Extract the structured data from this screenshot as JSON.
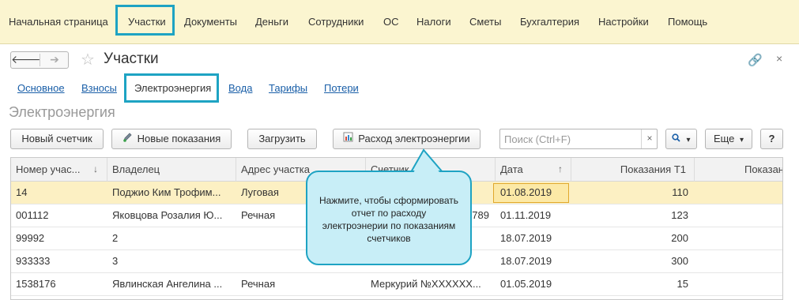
{
  "menu": {
    "items": [
      "Начальная страница",
      "Участки",
      "Документы",
      "Деньги",
      "Сотрудники",
      "ОС",
      "Налоги",
      "Сметы",
      "Бухгалтерия",
      "Настройки",
      "Помощь"
    ],
    "active": "Участки"
  },
  "header": {
    "back_icon": "arrow-left-icon",
    "forward_icon": "arrow-right-icon",
    "back_glyph": "🡐",
    "forward_glyph": "➔",
    "star_glyph": "☆",
    "link_glyph": "🔗",
    "close_glyph": "×",
    "title": "Участки"
  },
  "tabs": {
    "items": [
      "Основное",
      "Взносы",
      "Электроэнергия",
      "Вода",
      "Тарифы",
      "Потери"
    ],
    "active": "Электроэнергия"
  },
  "section_title": "Электроэнергия",
  "toolbar": {
    "new_meter": "Новый счетчик",
    "new_readings": "Новые показания",
    "load": "Загрузить",
    "consumption": "Расход электроэнергии",
    "search_placeholder": "Поиск (Ctrl+F)",
    "search_clear": "×",
    "search_button_glyph": "🔍",
    "dropdown_glyph": "▾",
    "more": "Еще",
    "help": "?"
  },
  "table": {
    "columns": [
      "Номер учас...",
      "Владелец",
      "Адрес участка",
      "Счетчик",
      "Дата",
      "Показания Т1",
      "Показан"
    ],
    "sort_down": "↓",
    "sort_up": "↑",
    "rows": [
      {
        "number": "14",
        "owner": "Поджио Ким Трофим...",
        "address": "Луговая",
        "meter": "",
        "date": "01.08.2019",
        "t1": "110",
        "selected": true
      },
      {
        "number": "001112",
        "owner": "Яковцова Розалия Ю...",
        "address": "Речная",
        "meter": "789",
        "date": "01.11.2019",
        "t1": "123",
        "selected": false
      },
      {
        "number": "99992",
        "owner": "2",
        "address": "",
        "meter": "",
        "date": "18.07.2019",
        "t1": "200",
        "selected": false
      },
      {
        "number": "933333",
        "owner": "3",
        "address": "",
        "meter": "",
        "date": "18.07.2019",
        "t1": "300",
        "selected": false
      },
      {
        "number": "1538176",
        "owner": "Явлинская Ангелина ...",
        "address": "Речная",
        "meter": "Меркурий №XXXXXX...",
        "date": "01.05.2019",
        "t1": "15",
        "selected": false
      }
    ]
  },
  "callout": {
    "text": "Нажмите, чтобы сформировать отчет по расходу электроэнерии по показаниям счетчиков"
  },
  "colors": {
    "menu_bg": "#fbf5d0",
    "highlight": "#1ea3c3",
    "callout_bg": "#c8eef7",
    "selected_row": "#fcf0c3",
    "link": "#1a5fa8"
  }
}
